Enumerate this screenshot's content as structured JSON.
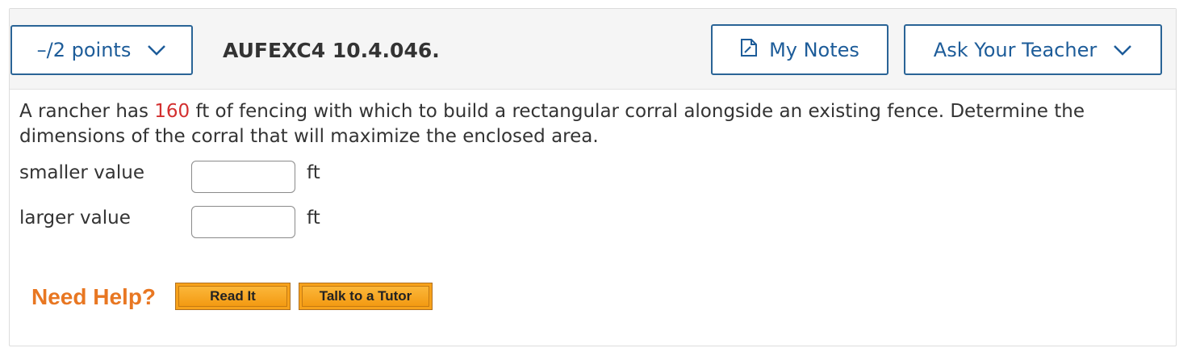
{
  "header": {
    "points_label": "–/2 points",
    "question_id": "AUFEXC4 10.4.046.",
    "my_notes_label": "My Notes",
    "ask_teacher_label": "Ask Your Teacher"
  },
  "question": {
    "text_before": "A rancher has ",
    "highlight": "160",
    "text_after": " ft of fencing with which to build a rectangular corral alongside an existing fence. Determine the dimensions of the corral that will maximize the enclosed area."
  },
  "answers": [
    {
      "label": "smaller value",
      "value": "",
      "unit": "ft"
    },
    {
      "label": "larger value",
      "value": "",
      "unit": "ft"
    }
  ],
  "help": {
    "label": "Need Help?",
    "read_it": "Read It",
    "talk_tutor": "Talk to a Tutor"
  },
  "colors": {
    "accent": "#1d5c99",
    "highlight": "#d32f2f",
    "help_text": "#e87722",
    "help_button": "#f7a21b"
  }
}
